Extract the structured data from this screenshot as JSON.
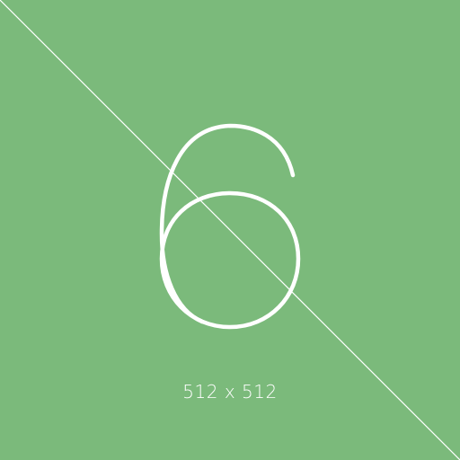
{
  "tile": {
    "digit": "6",
    "caption": "512 x 512",
    "background_color": "#7bba7b",
    "foreground_color": "#ffffff"
  }
}
